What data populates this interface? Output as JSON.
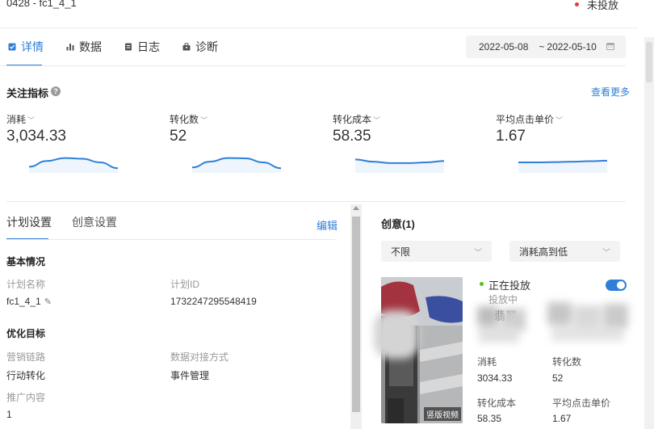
{
  "header": {
    "plan_title": "0428 - fc1_4_1",
    "status": "未投放",
    "status_color": "#e53935"
  },
  "tabs": [
    {
      "label": "详情",
      "icon": "checkbox-icon",
      "active": true
    },
    {
      "label": "数据",
      "icon": "bar-chart-icon",
      "active": false
    },
    {
      "label": "日志",
      "icon": "document-icon",
      "active": false
    },
    {
      "label": "诊断",
      "icon": "toolbox-icon",
      "active": false
    }
  ],
  "date_range": {
    "start": "2022-05-08",
    "separator": "~",
    "end": "2022-05-10",
    "icon": "calendar-icon"
  },
  "metrics_section": {
    "title": "关注指标",
    "help_icon": "?",
    "more_link": "查看更多",
    "metrics": [
      {
        "label": "消耗",
        "value": "3,034.33",
        "trend": [
          0.2,
          0.6,
          0.8,
          0.75,
          0.5,
          0.1
        ]
      },
      {
        "label": "转化数",
        "value": "52",
        "trend": [
          0.15,
          0.55,
          0.8,
          0.78,
          0.5,
          0.1
        ]
      },
      {
        "label": "转化成本",
        "value": "58.35",
        "trend": [
          0.7,
          0.55,
          0.45,
          0.45,
          0.5,
          0.6
        ]
      },
      {
        "label": "平均点击单价",
        "value": "1.67",
        "trend": [
          0.5,
          0.5,
          0.52,
          0.55,
          0.58,
          0.62
        ]
      }
    ],
    "accent_color": "#2f7fd8"
  },
  "plan_panel": {
    "tabs": [
      {
        "label": "计划设置",
        "active": true
      },
      {
        "label": "创意设置",
        "active": false
      }
    ],
    "edit_label": "编辑",
    "basic_title": "基本情况",
    "plan_name_label": "计划名称",
    "plan_name_value": "fc1_4_1",
    "plan_id_label": "计划ID",
    "plan_id_value": "1732247295548419",
    "goal_title": "优化目标",
    "marketing_label": "营销链路",
    "marketing_value": "行动转化",
    "data_method_label": "数据对接方式",
    "data_method_value": "事件管理",
    "promo_label": "推广内容",
    "promo_value": "1"
  },
  "creative_panel": {
    "title": "创意(1)",
    "filter_select": "不限",
    "sort_select": "消耗高到低",
    "thumb_badge": "竖版视频",
    "status_text": "正在投放",
    "status_sub": "投放中",
    "obscured_text": "翡翠",
    "stats": [
      {
        "label": "消耗",
        "value": "3034.33"
      },
      {
        "label": "转化数",
        "value": "52"
      },
      {
        "label": "转化成本",
        "value": "58.35"
      },
      {
        "label": "平均点击单价",
        "value": "1.67"
      }
    ]
  }
}
